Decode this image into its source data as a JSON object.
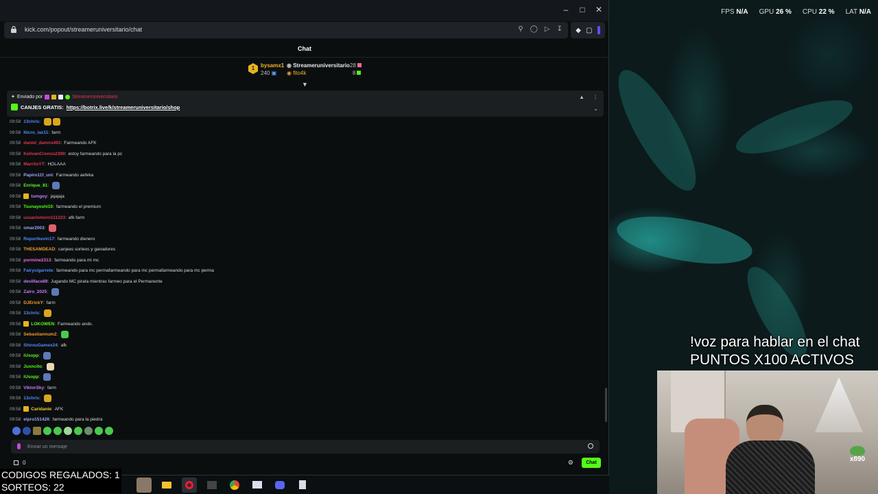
{
  "overlay": {
    "fps_label": "FPS",
    "fps_value": "N/A",
    "gpu_label": "GPU",
    "gpu_value": "26 %",
    "cpu_label": "CPU",
    "cpu_value": "22 %",
    "lat_label": "LAT",
    "lat_value": "N/A"
  },
  "stream": {
    "promo_line1": "!voz para hablar en el chat",
    "promo_line2": "PUNTOS X100 ACTIVOS",
    "webcam_logo_text": "x890",
    "counter_codes": "CODIGOS REGALADOS: 1",
    "counter_draws": "SORTEOS: 22"
  },
  "browser": {
    "url": "kick.com/popout/streameruniversitario/chat"
  },
  "chat": {
    "title": "Chat",
    "leaderboard": {
      "rank": "1",
      "top_user": "bysamx1",
      "top_user_count": "240",
      "user2": "Streameruniversitario",
      "user2_count": "28",
      "user3": "fito4k",
      "user3_count": "8"
    },
    "pinned": {
      "sent_by": "Enviado por",
      "author": "Streameruniversitario",
      "message_prefix": "CANJES GRATIS:",
      "link": "https://botrix.live/k/streameruniversitario/shop"
    },
    "messages": [
      {
        "time": "09:58",
        "user": "13chris",
        "color": "#4f8bff",
        "text": "",
        "emotes": [
          "#d9a520",
          "#d9a520"
        ]
      },
      {
        "time": "09:58",
        "user": "Nicro_lax11",
        "color": "#4f8bff",
        "text": "farm"
      },
      {
        "time": "09:58",
        "user": "daniel_damns491",
        "color": "#e0364f",
        "text": "Farmeando AFK"
      },
      {
        "time": "09:58",
        "user": "KelivanCronos2399",
        "color": "#e0364f",
        "text": "estoy farmeando para la pc"
      },
      {
        "time": "09:58",
        "user": "MarritoYT",
        "color": "#e0364f",
        "text": "HOLAAA"
      },
      {
        "time": "09:58",
        "user": "Papiro11f_uni",
        "color": "#9aa7ff",
        "text": "Farmeando aefeka"
      },
      {
        "time": "09:58",
        "user": "Enrique_81",
        "color": "#53fc18",
        "text": "",
        "emotes": [
          "#5e7ab8"
        ]
      },
      {
        "time": "09:58",
        "user": "tumgoy",
        "color": "#c77dff",
        "text": "jajajaja",
        "badge": true
      },
      {
        "time": "09:58",
        "user": "Tsunayoshi10",
        "color": "#53fc18",
        "text": "farmeando el premium"
      },
      {
        "time": "09:58",
        "user": "usuariomorn111223",
        "color": "#e0364f",
        "text": "afk farm"
      },
      {
        "time": "09:58",
        "user": "omar2003",
        "color": "#9aa7ff",
        "text": "",
        "emotes": [
          "#e06070"
        ]
      },
      {
        "time": "09:58",
        "user": "Reportkevin17",
        "color": "#4f8bff",
        "text": "farmeando dienero"
      },
      {
        "time": "09:58",
        "user": "THESAMDEAD",
        "color": "#f29a2e",
        "text": "canjees sorteos y ganadores"
      },
      {
        "time": "09:58",
        "user": "pormine2313",
        "color": "#f26bd0",
        "text": "farmeando para mi mc"
      },
      {
        "time": "09:58",
        "user": "Fairycigarrete",
        "color": "#4f8bff",
        "text": "farmeando para mc permafarmeando para mc permafarmeando para mc perma"
      },
      {
        "time": "09:58",
        "user": "devilface89",
        "color": "#c77dff",
        "text": "Jugando MC pirata mientras farmeo para el Permanente"
      },
      {
        "time": "09:58",
        "user": "Zairo_2025",
        "color": "#c77dff",
        "text": "",
        "emotes": [
          "#5e7ab8"
        ]
      },
      {
        "time": "09:58",
        "user": "DJErickY",
        "color": "#f29a2e",
        "text": "farm"
      },
      {
        "time": "09:58",
        "user": "13chris",
        "color": "#4f8bff",
        "text": "",
        "emotes": [
          "#d9a520"
        ]
      },
      {
        "time": "09:58",
        "user": "LOKOWEN",
        "color": "#53fc18",
        "text": "Farmeando ando.",
        "badge": true
      },
      {
        "time": "09:58",
        "user": "Sebastiannum2",
        "color": "#f29a2e",
        "text": "",
        "emotes": [
          "#4cc94c"
        ]
      },
      {
        "time": "09:58",
        "user": "ShirouGamex24",
        "color": "#4f8bff",
        "text": "afk"
      },
      {
        "time": "09:58",
        "user": "iUsopp",
        "color": "#53fc18",
        "text": "",
        "emotes": [
          "#5e7ab8"
        ]
      },
      {
        "time": "09:58",
        "user": "Juxncito",
        "color": "#53fc18",
        "text": "",
        "emotes": [
          "#e8d8b0"
        ]
      },
      {
        "time": "09:58",
        "user": "iUsopp",
        "color": "#53fc18",
        "text": "",
        "emotes": [
          "#5e7ab8"
        ]
      },
      {
        "time": "09:58",
        "user": "ViktorSky",
        "color": "#c77dff",
        "text": "farm"
      },
      {
        "time": "09:58",
        "user": "13chris",
        "color": "#4f8bff",
        "text": "",
        "emotes": [
          "#d9a520"
        ]
      },
      {
        "time": "09:58",
        "user": "Caridanie",
        "color": "#f2d02e",
        "text": "AFK",
        "badge": true
      },
      {
        "time": "09:58",
        "user": "elpro151426",
        "color": "#9aa7ff",
        "text": "farmeando para la piedra"
      }
    ],
    "input_placeholder": "Enviar un mensaje",
    "points": "0",
    "send_button": "Chat"
  }
}
